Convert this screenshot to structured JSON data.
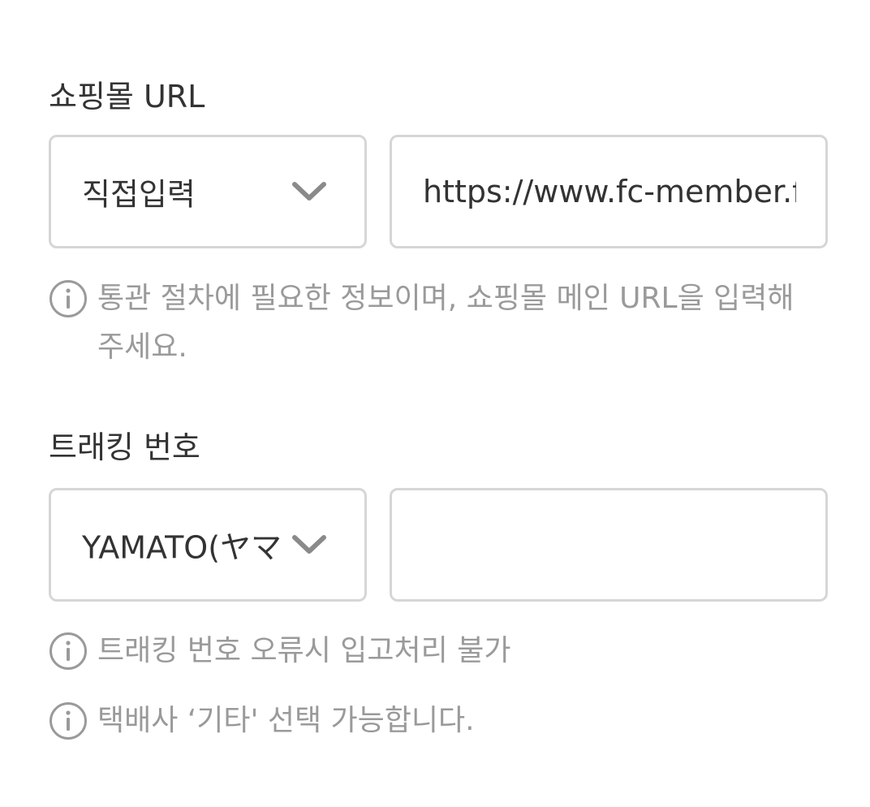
{
  "shop_url": {
    "label": "쇼핑몰 URL",
    "select_value": "직접입력",
    "input_value": "https://www.fc-member.f",
    "hint": "통관 절차에 필요한 정보이며, 쇼핑몰 메인 URL을 입력해 주세요."
  },
  "tracking": {
    "label": "트래킹 번호",
    "select_value": "YAMATO(ヤマ",
    "input_value": "",
    "hints": [
      "트래킹 번호 오류시 입고처리 불가",
      "택배사 ‘기타' 선택 가능합니다."
    ]
  },
  "icons": {
    "select_arrow": "chevron-down-icon",
    "hint_icon": "info-icon"
  },
  "colors": {
    "border": "#d6d6d6",
    "text": "#333333",
    "hint_text": "#9a9a9a",
    "chevron": "#8a8a8a"
  }
}
